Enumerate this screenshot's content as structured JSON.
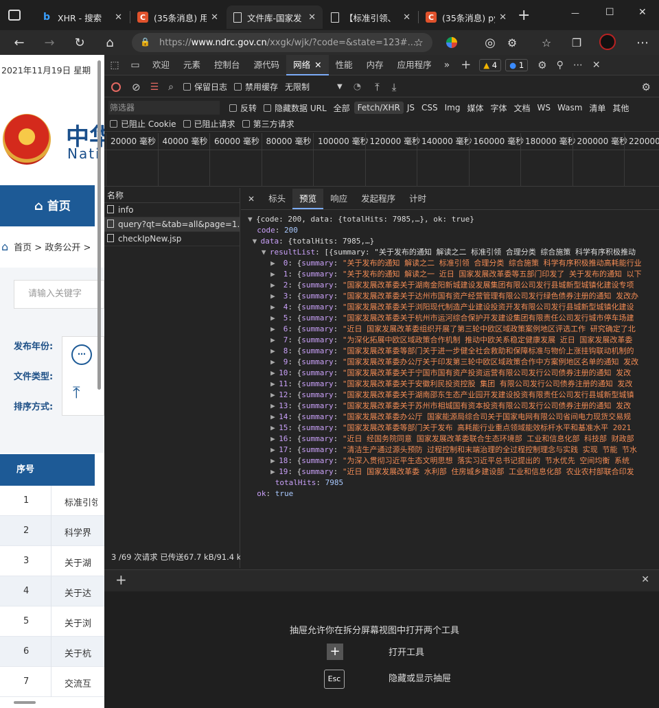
{
  "tabs": [
    {
      "label": "XHR - 搜索"
    },
    {
      "label": "(35条消息) 用"
    },
    {
      "label": "文件库-国家发"
    },
    {
      "label": "【标准引领、"
    },
    {
      "label": "(35条消息) py"
    }
  ],
  "window": {
    "minimize": "—",
    "maximize": "☐",
    "close": "✕"
  },
  "address": {
    "prefix": "https://",
    "host": "www.ndrc.gov.cn",
    "path": "/xxgk/wjk/?code=&state=123#..."
  },
  "page": {
    "date": "2021年11月19日 星期",
    "logo_text": "中华",
    "logo_sub": "Nati",
    "nav_home": "首页",
    "breadcrumb": "首页 > 政务公开 >",
    "search_placeholder": "请输入关键字",
    "filters": [
      "发布年份:",
      "文件类型:",
      "排序方式:"
    ],
    "table_header": "序号",
    "rows": [
      {
        "num": "1",
        "title": "标准引领"
      },
      {
        "num": "2",
        "title": "科学界"
      },
      {
        "num": "3",
        "title": "关于湖"
      },
      {
        "num": "4",
        "title": "关于达"
      },
      {
        "num": "5",
        "title": "关于浏"
      },
      {
        "num": "6",
        "title": "关于杭"
      },
      {
        "num": "7",
        "title": "交流互"
      }
    ]
  },
  "devtools": {
    "main_tabs": [
      "欢迎",
      "元素",
      "控制台",
      "源代码",
      "网络",
      "性能",
      "内存",
      "应用程序"
    ],
    "warn_count": "4",
    "info_count": "1",
    "toolbar": {
      "preserve_log": "保留日志",
      "disable_cache": "禁用缓存",
      "throttle": "无限制"
    },
    "filter": {
      "placeholder": "筛选器",
      "invert": "反转",
      "hide_data": "隐藏数据 URL",
      "all": "全部",
      "types": [
        "Fetch/XHR",
        "JS",
        "CSS",
        "Img",
        "媒体",
        "字体",
        "文档",
        "WS",
        "Wasm",
        "清单",
        "其他"
      ],
      "blocked_cookie": "已阻止 Cookie",
      "blocked_req": "已阻止请求",
      "third_party": "第三方请求"
    },
    "timeline": [
      "20000 毫秒",
      "40000 毫秒",
      "60000 毫秒",
      "80000 毫秒",
      "100000 毫秒",
      "120000 毫秒",
      "140000 毫秒",
      "160000 毫秒",
      "180000 毫秒",
      "200000 毫秒",
      "220000"
    ],
    "name_header": "名称",
    "requests": [
      "info",
      "query?qt=&tab=all&page=1...",
      "checkIpNew.jsp"
    ],
    "status": "3 /69 次请求  已传送67.7 kB/91.4 kB",
    "detail_tabs": [
      "标头",
      "预览",
      "响应",
      "发起程序",
      "计时"
    ],
    "json": {
      "root": "{code: 200, data: {totalHits: 7985,…}, ok: true}",
      "code": "200",
      "data_summary": "{totalHits: 7985,…}",
      "result_head": "[{summary: \"关于发布的通知 解读之二 标准引领 合理分类 综合施策 科学有序积极推动",
      "items": [
        "关于发布的通知 解读之二 标准引领 合理分类 综合施策 科学有序积极推动高耗能行业",
        "关于发布的通知 解读之一 近日 国家发展改革委等五部门印发了 关于发布的通知 以下",
        "国家发展改革委关于湖南金阳新城建设发展集团有限公司发行县城新型城镇化建设专项",
        "国家发展改革委关于达州市国有资产经营管理有限公司发行绿色债券注册的通知 发改办",
        "国家发展改革委关于浏阳现代制造产业建设投资开发有限公司发行县城新型城镇化建设",
        "国家发展改革委关于杭州市运河综合保护开发建设集团有限责任公司发行城市停车场建",
        "近日 国家发展改革委组织开展了第三轮中欧区域政策案例地区评选工作 研究确定了北",
        "为深化拓展中欧区域政策合作机制 推动中欧关系稳定健康发展 近日 国家发展改革委",
        "国家发展改革委等部门关于进一步健全社会救助和保障标准与物价上涨挂钩联动机制的",
        "国家发展改革委办公厅关于印发第三轮中欧区域政策合作中方案例地区名单的通知 发改",
        "国家发展改革委关于宁国市国有资产投资运营有限公司发行公司债券注册的通知 发改",
        "国家发展改革委关于安徽利民投资控股 集团 有限公司发行公司债券注册的通知 发改",
        "国家发展改革委关于湖南邵东生态产业园开发建设投资有限责任公司发行县城新型城镇",
        "国家发展改革委关于苏州市相城国有资本投资有限公司发行公司债券注册的通知 发改",
        "国家发展改革委办公厅 国家能源局综合司关于国家电网有限公司省间电力现货交易规",
        "国家发展改革委等部门关于发布 高耗能行业重点领域能效标杆水平和基准水平 2021",
        "近日 经国务院同意 国家发展改革委联合生态环境部 工业和信息化部 科技部 财政部",
        "清洁生产通过源头预防 过程控制和末端治理的全过程控制理念与实践 实现 节能 节水",
        "为深入贯彻习近平生态文明思想 落实习近平总书记提出的 节水优先 空间均衡 系统",
        "近日 国家发展改革委 水利部 住房城乡建设部 工业和信息化部 农业农村部联合印发"
      ],
      "total_hits": "7985",
      "ok": "true"
    },
    "drawer": {
      "hint": "抽屉允许你在拆分屏幕视图中打开两个工具",
      "open_tool": "打开工具",
      "toggle": "隐藏或显示抽屉",
      "esc": "Esc"
    }
  }
}
